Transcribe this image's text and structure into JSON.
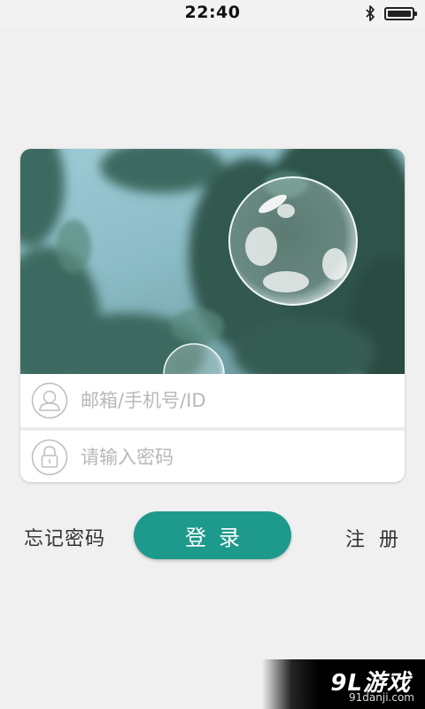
{
  "status_bar": {
    "time": "22:40",
    "icons": [
      "bluetooth-icon",
      "battery-icon"
    ]
  },
  "login": {
    "username_placeholder": "邮箱/手机号/ID",
    "username_value": "",
    "password_placeholder": "请输入密码",
    "password_value": "",
    "forgot_label": "忘记密码",
    "login_label": "登录",
    "register_label": "注册",
    "accent_color": "#1e9a8c"
  },
  "watermark": {
    "title": "9L游戏",
    "url": "91danji.com"
  }
}
